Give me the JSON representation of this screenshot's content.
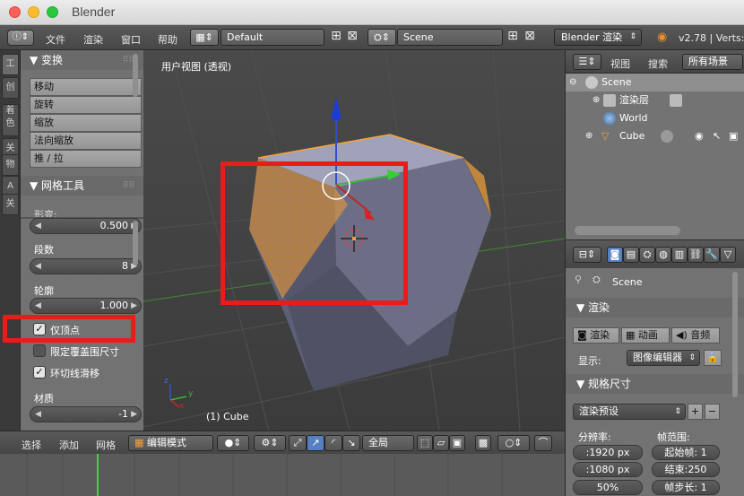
{
  "window": {
    "title": "Blender"
  },
  "topbar": {
    "menus": [
      "文件",
      "渲染",
      "窗口",
      "帮助"
    ],
    "screen_layout": "Default",
    "scene": "Scene",
    "render_engine": "Blender 渲染",
    "version": "v2.78 | Verts:"
  },
  "toolshelf": {
    "tabs": [
      "工",
      "创",
      "着色",
      "关",
      "物",
      "A",
      "关"
    ],
    "transform_panel": {
      "title": "变换",
      "buttons": [
        "移动",
        "旋转",
        "缩放",
        "法向缩放",
        "推 / 拉"
      ]
    },
    "mesh_tools_panel": {
      "title": "网格工具",
      "partial_label": "形变:"
    },
    "operator": {
      "value_top": "0.500",
      "segments_label": "段数",
      "segments_value": "8",
      "profile_label": "轮廓",
      "profile_value": "1.000",
      "vertex_only_label": "仅顶点",
      "vertex_only_checked": true,
      "clamp_overlap_label": "限定覆盖围尺寸",
      "clamp_overlap_checked": false,
      "loop_slide_label": "环切线滑移",
      "loop_slide_checked": true,
      "material_label": "材质",
      "material_value": "-1"
    }
  },
  "viewport": {
    "title": "用户视图 (透视)",
    "object_label": "(1) Cube",
    "axis_labels": {
      "z": "z",
      "y": "y",
      "x": "x"
    }
  },
  "bottombar": {
    "menus": [
      "选择",
      "添加",
      "网格"
    ],
    "mode": "编辑模式",
    "pivot": "全局"
  },
  "outliner": {
    "header": {
      "view": "视图",
      "search": "搜索",
      "filter": "所有场景"
    },
    "items": [
      {
        "label": "Scene"
      },
      {
        "label": "渲染层"
      },
      {
        "label": "World"
      },
      {
        "label": "Cube"
      }
    ]
  },
  "properties": {
    "scene_label": "Scene",
    "render_panel": {
      "title": "渲染",
      "render_btn": "渲染",
      "anim_btn": "动画",
      "audio_btn": "音频",
      "display_label": "显示:",
      "display_value": "图像编辑器"
    },
    "dimensions_panel": {
      "title": "规格尺寸",
      "preset": "渲染预设",
      "resolution_label": "分辨率:",
      "res_x": ":1920 px",
      "res_y": ":1080 px",
      "res_pct": "50%",
      "frame_range_label": "帧范围:",
      "start": "起始帧: 1",
      "end": "结束:250",
      "step": "帧步长: 1"
    }
  },
  "colors": {
    "highlight": "#ea1b1b",
    "selection_orange": "#f5a33b",
    "accent_blue": "#5680c2"
  }
}
